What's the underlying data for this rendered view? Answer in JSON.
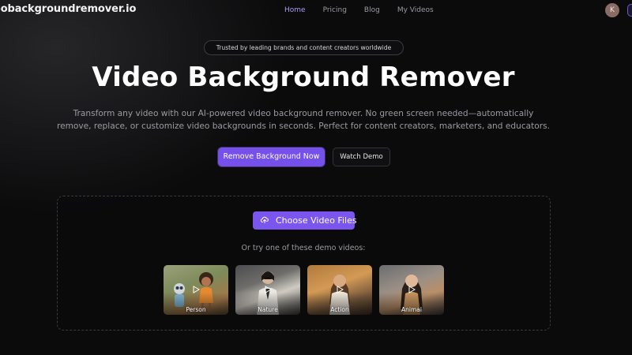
{
  "nav": {
    "logo": "eobackgroundremover.io",
    "links": [
      {
        "label": "Home",
        "active": true
      },
      {
        "label": "Pricing",
        "active": false
      },
      {
        "label": "Blog",
        "active": false
      },
      {
        "label": "My Videos",
        "active": false
      }
    ],
    "avatar_initial": "K"
  },
  "hero": {
    "badge": "Trusted by leading brands and content creators worldwide",
    "title": "Video Background Remover",
    "subtitle_line1": "Transform any video with our AI-powered video background remover. No green screen needed—automatically",
    "subtitle_line2": "remove, replace, or customize video backgrounds in seconds. Perfect for content creators, marketers, and educators.",
    "primary_cta": "Remove Background Now",
    "secondary_cta": "Watch Demo"
  },
  "upload": {
    "choose_label": "Choose Video Files",
    "demo_hint": "Or try one of these demo videos:",
    "demos": [
      {
        "label": "Person"
      },
      {
        "label": "Nature"
      },
      {
        "label": "Action"
      },
      {
        "label": "Animal"
      }
    ]
  },
  "colors": {
    "accent": "#7650ea",
    "nav_active": "#a99cf6",
    "background": "#0b0b0c"
  },
  "icons": [
    "upload-cloud-icon",
    "play-icon"
  ]
}
